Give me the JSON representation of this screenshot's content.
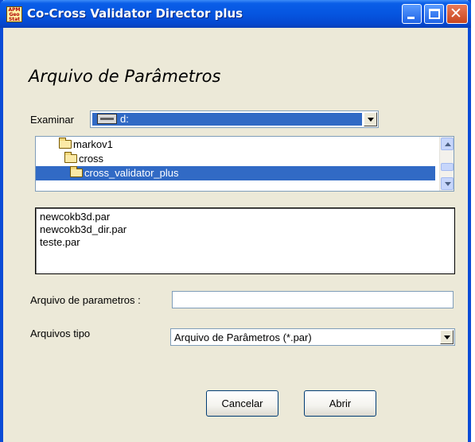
{
  "window": {
    "title": "Co-Cross Validator Director plus",
    "icon_text_top": "APM",
    "icon_text_bottom": "Geo Stat"
  },
  "dialog": {
    "heading": "Arquivo de Parâmetros",
    "examinar_label": "Examinar",
    "examinar_value": "d:",
    "folders": [
      {
        "name": "markov1",
        "selected": false
      },
      {
        "name": "cross",
        "selected": false
      },
      {
        "name": "cross_validator_plus",
        "selected": true
      }
    ],
    "files": [
      "newcokb3d.par",
      "newcokb3d_dir.par",
      "teste.par"
    ],
    "filename_label": "Arquivo de parametros :",
    "filename_value": "",
    "filetype_label": "Arquivos tipo",
    "filetype_value": "Arquivo de Parâmetros (*.par)",
    "cancel_label": "Cancelar",
    "open_label": "Abrir"
  },
  "colors": {
    "titlebar": "#0555e0",
    "selection": "#316ac5",
    "window_bg": "#ece9d8"
  }
}
